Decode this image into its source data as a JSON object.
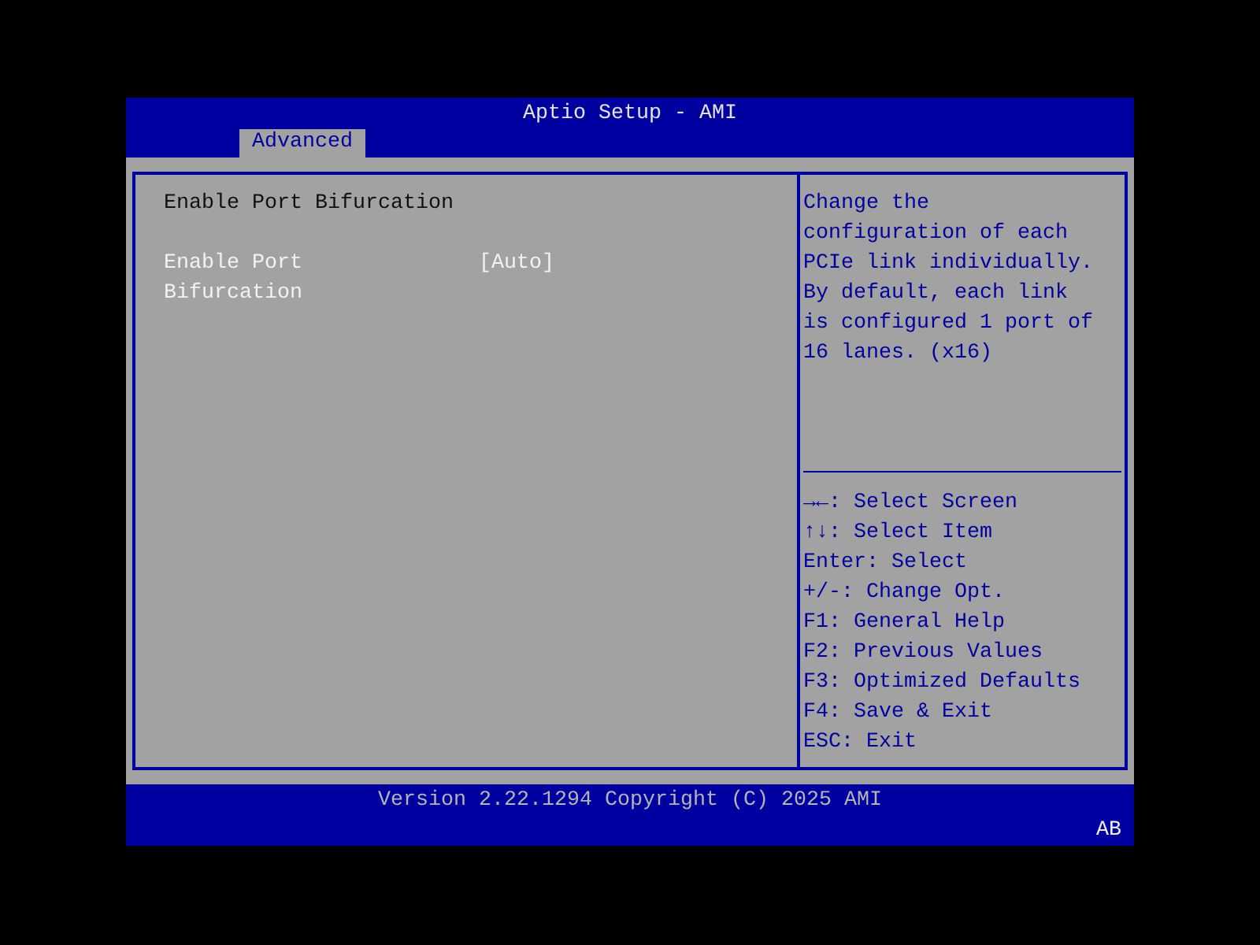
{
  "window": {
    "title": "Aptio Setup - AMI"
  },
  "tabs": [
    {
      "label": "Advanced",
      "selected": true
    }
  ],
  "main": {
    "heading": "Enable Port Bifurcation",
    "settings": [
      {
        "label": "Enable Port Bifurcation",
        "value": "[Auto]",
        "selected": true
      }
    ]
  },
  "help": {
    "description": "Change the configuration of each PCIe link individually. By default, each link is configured 1 port of 16 lanes. (x16)",
    "keys": [
      "→←: Select Screen",
      "↑↓: Select Item",
      "Enter: Select",
      "+/-: Change Opt.",
      "F1: General Help",
      "F2: Previous Values",
      "F3: Optimized Defaults",
      "F4: Save & Exit",
      "ESC: Exit"
    ]
  },
  "footer": {
    "version": "Version 2.22.1294 Copyright (C) 2025 AMI",
    "badge": "AB"
  }
}
